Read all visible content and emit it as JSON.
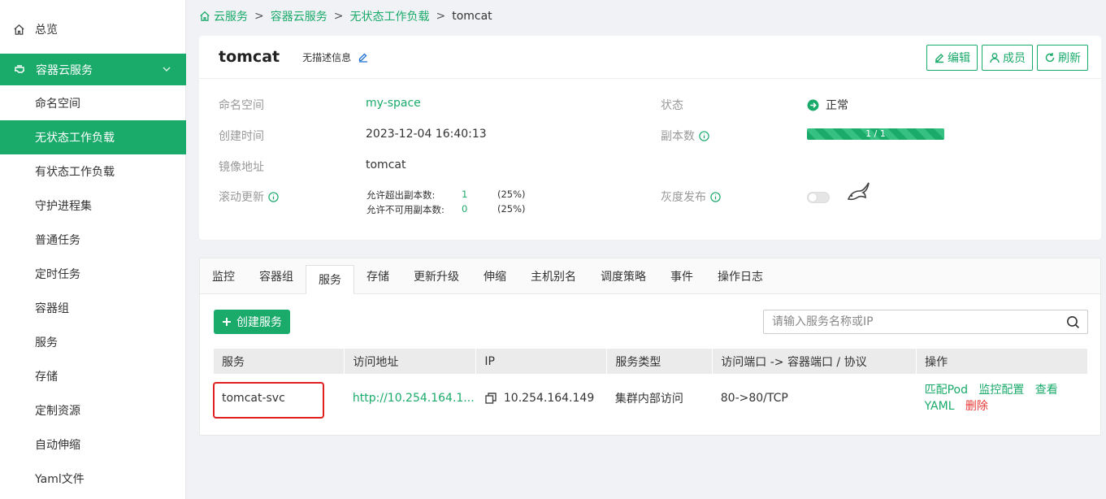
{
  "sidebar": {
    "overview": "总览",
    "group": "容器云服务",
    "items": [
      {
        "label": "命名空间",
        "active": false
      },
      {
        "label": "无状态工作负载",
        "active": true
      },
      {
        "label": "有状态工作负载",
        "active": false
      },
      {
        "label": "守护进程集",
        "active": false
      },
      {
        "label": "普通任务",
        "active": false
      },
      {
        "label": "定时任务",
        "active": false
      },
      {
        "label": "容器组",
        "active": false
      },
      {
        "label": "服务",
        "active": false
      },
      {
        "label": "存储",
        "active": false
      },
      {
        "label": "定制资源",
        "active": false
      },
      {
        "label": "自动伸缩",
        "active": false
      },
      {
        "label": "Yaml文件",
        "active": false
      }
    ]
  },
  "breadcrumb": {
    "home": "云服务",
    "level2": "容器云服务",
    "level3": "无状态工作负载",
    "current": "tomcat",
    "sep": ">"
  },
  "detail": {
    "name": "tomcat",
    "description": "无描述信息",
    "buttons": {
      "edit": "编辑",
      "members": "成员",
      "refresh": "刷新"
    },
    "namespace_label": "命名空间",
    "namespace_value": "my-space",
    "created_label": "创建时间",
    "created_value": "2023-12-04 16:40:13",
    "image_label": "镜像地址",
    "image_value": "tomcat",
    "rolling_label": "滚动更新",
    "max_surge_label": "允许超出副本数:",
    "max_surge_value": "1",
    "max_surge_pct": "(25%)",
    "max_unavail_label": "允许不可用副本数:",
    "max_unavail_value": "0",
    "max_unavail_pct": "(25%)",
    "status_label": "状态",
    "status_value": "正常",
    "replicas_label": "副本数",
    "replicas_value": "1 / 1",
    "canary_label": "灰度发布",
    "canary_enabled": false
  },
  "tabs": [
    {
      "label": "监控",
      "active": false
    },
    {
      "label": "容器组",
      "active": false
    },
    {
      "label": "服务",
      "active": true
    },
    {
      "label": "存储",
      "active": false
    },
    {
      "label": "更新升级",
      "active": false
    },
    {
      "label": "伸缩",
      "active": false
    },
    {
      "label": "主机别名",
      "active": false
    },
    {
      "label": "调度策略",
      "active": false
    },
    {
      "label": "事件",
      "active": false
    },
    {
      "label": "操作日志",
      "active": false
    }
  ],
  "services": {
    "create_label": "创建服务",
    "search_placeholder": "请输入服务名称或IP",
    "columns": [
      "服务",
      "访问地址",
      "IP",
      "服务类型",
      "访问端口 -> 容器端口 / 协议",
      "操作"
    ],
    "rows": [
      {
        "name": "tomcat-svc",
        "address": "http://10.254.164.1...",
        "ip": "10.254.164.149",
        "type": "集群内部访问",
        "ports": "80->80/TCP",
        "actions": {
          "match_pod": "匹配Pod",
          "monitor": "监控配置",
          "view_yaml": "查看 YAML",
          "delete": "删除"
        }
      }
    ]
  },
  "colors": {
    "accent": "#1aaa6a",
    "danger": "#e53935",
    "highlight": "#e02020"
  }
}
